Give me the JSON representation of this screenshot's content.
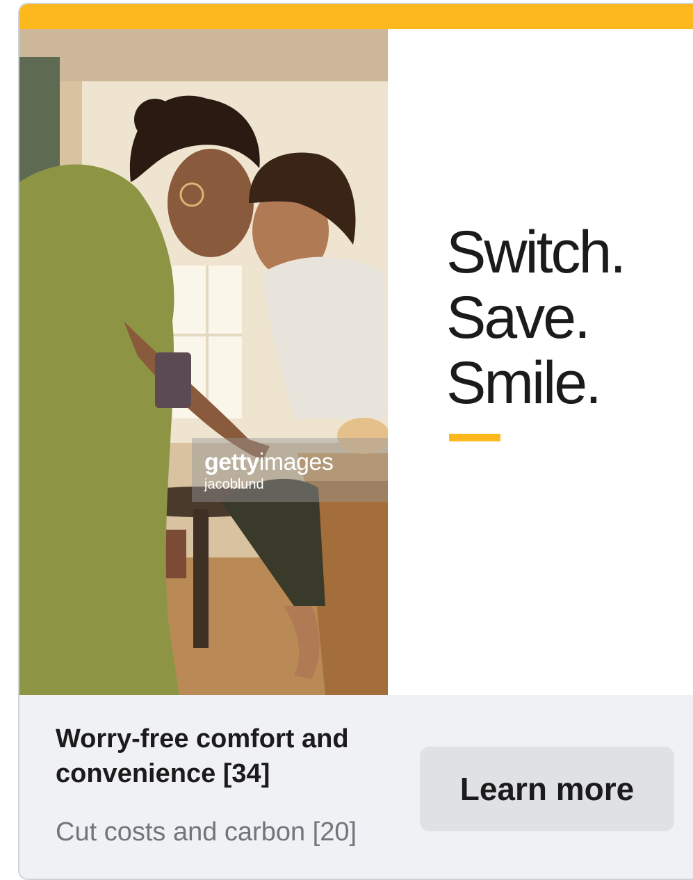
{
  "ad": {
    "accent_color": "#fdb81e",
    "headline": [
      "Switch.",
      "Save.",
      "Smile."
    ],
    "photo": {
      "watermark_brand_bold": "getty",
      "watermark_brand_light": "images",
      "watermark_credit": "jacoblund"
    },
    "footer": {
      "title": "Worry-free comfort and convenience [34]",
      "subtitle": "Cut costs and carbon [20]",
      "cta_label": "Learn more"
    }
  }
}
